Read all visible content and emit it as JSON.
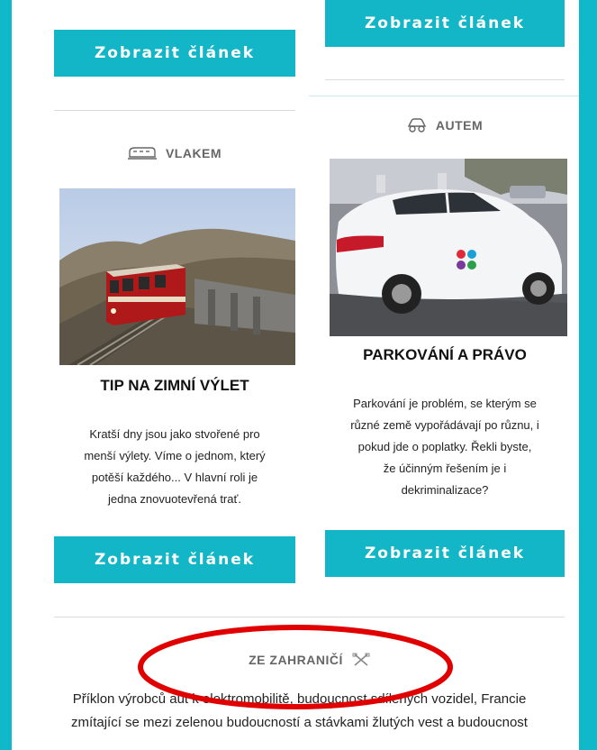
{
  "colors": {
    "accent": "#13b6c7",
    "annotation_circle": "#e00000"
  },
  "left_card": {
    "top_button_label": "Zobrazit článek",
    "category": {
      "label": "VLAKEM",
      "icon": "train-icon"
    },
    "title": "TIP NA ZIMNÍ VÝLET",
    "description_lines": [
      "Kratší dny jsou jako stvořené pro",
      "menší výlety. Víme o jednom, který",
      "potěší každého...  V hlavní roli je",
      "jedna znovuotevřená trať."
    ],
    "button_label": "Zobrazit článek"
  },
  "right_card": {
    "top_button_label": "Zobrazit článek",
    "category": {
      "label": "AUTEM",
      "icon": "car-icon"
    },
    "title": "PARKOVÁNÍ A PRÁVO",
    "description_lines": [
      "Parkování je problém, se kterým se",
      "různé země vypořádávají po různu, i",
      "pokud jde o poplatky. Řekli byste,",
      "že účinným řešením je i",
      "dekriminalizace?"
    ],
    "button_label": "Zobrazit článek"
  },
  "international": {
    "category": {
      "label": "ZE ZAHRANIČÍ",
      "icon": "crossed-tools-icon"
    },
    "text_lines": [
      "Příklon výrobců aut k elektromobilitě, budoucnost sdílených vozidel, Francie",
      "zmítající se mezi zelenou budoucností a stávkami žlutých vest a budoucnost"
    ]
  }
}
